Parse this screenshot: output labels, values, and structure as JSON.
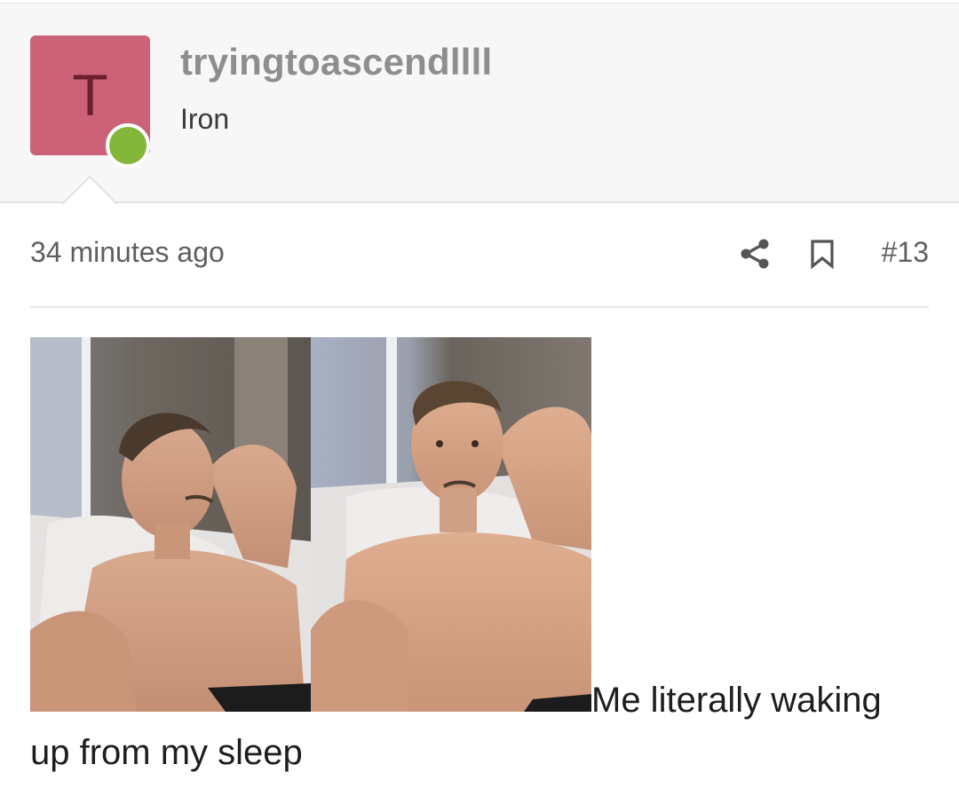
{
  "author": {
    "avatar_letter": "T",
    "avatar_color": "#cc6278",
    "online_color": "#84b63a",
    "username": "tryingtoascendllll",
    "title": "Iron"
  },
  "meta": {
    "timestamp": "34 minutes ago",
    "share_icon": "share-icon",
    "bookmark_icon": "bookmark-icon",
    "post_number": "#13"
  },
  "content": {
    "images": [
      {
        "name": "selfie-photo-1",
        "description_icon": "photo"
      },
      {
        "name": "selfie-photo-2",
        "description_icon": "photo"
      }
    ],
    "text": "Me literally waking up from my sleep"
  }
}
